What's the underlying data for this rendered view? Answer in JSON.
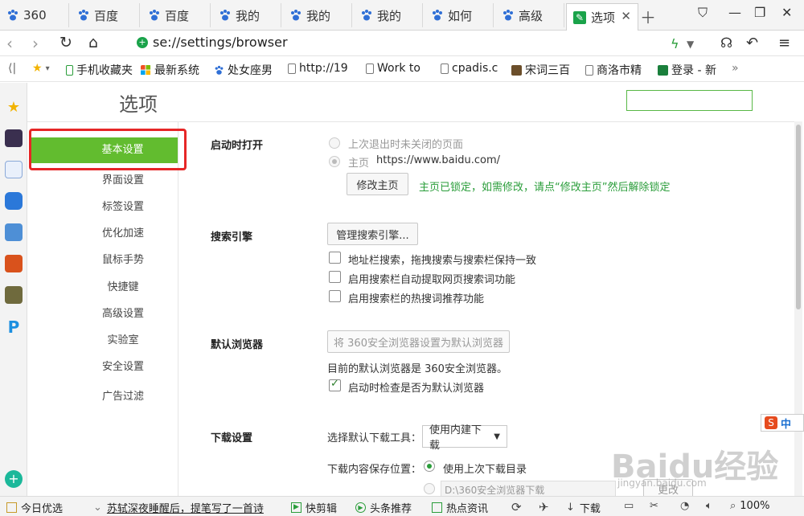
{
  "tabs": [
    {
      "label": "360",
      "icon": "baidu-paw-icon"
    },
    {
      "label": "百度",
      "icon": "baidu-paw-icon"
    },
    {
      "label": "百度",
      "icon": "baidu-paw-icon"
    },
    {
      "label": "我的",
      "icon": "baidu-paw-icon"
    },
    {
      "label": "我的",
      "icon": "baidu-paw-icon"
    },
    {
      "label": "我的",
      "icon": "baidu-paw-icon"
    },
    {
      "label": "如何",
      "icon": "baidu-paw-icon"
    },
    {
      "label": "高级",
      "icon": "baidu-paw-icon"
    },
    {
      "label": "选项",
      "icon": "settings-icon",
      "active": true
    }
  ],
  "address": {
    "url": "se://settings/browser"
  },
  "bookmarks": [
    {
      "label": "手机收藏夹",
      "icon": "phone-icon"
    },
    {
      "label": "最新系统",
      "icon": "windows-icon"
    },
    {
      "label": "处女座男",
      "icon": "baidu-paw-icon"
    },
    {
      "label": "http://19",
      "icon": "page-icon"
    },
    {
      "label": "Work to",
      "icon": "page-icon"
    },
    {
      "label": "cpadis.c",
      "icon": "page-icon"
    },
    {
      "label": "宋词三百",
      "icon": "site-icon"
    },
    {
      "label": "商洛市精",
      "icon": "page-icon"
    },
    {
      "label": "登录 - 新",
      "icon": "login-icon"
    }
  ],
  "bookmarks_more": "»",
  "page": {
    "title": "选项"
  },
  "nav": [
    {
      "label": "基本设置",
      "active": true
    },
    {
      "label": "界面设置"
    },
    {
      "label": "标签设置"
    },
    {
      "label": "优化加速"
    },
    {
      "label": "鼠标手势"
    },
    {
      "label": "快捷键"
    },
    {
      "label": "高级设置"
    },
    {
      "label": "实验室"
    },
    {
      "label": "安全设置"
    },
    {
      "label": "广告过滤"
    }
  ],
  "startup": {
    "title": "启动时打开",
    "opt1": "上次退出时未关闭的页面",
    "opt2_label": "主页",
    "opt2_url": "https://www.baidu.com/",
    "modify_btn": "修改主页",
    "lock_notice": "主页已锁定，如需修改，请点“修改主页”然后解除锁定"
  },
  "search": {
    "title": "搜索引擎",
    "manage_btn": "管理搜索引擎...",
    "chk1": "地址栏搜索，拖拽搜索与搜索栏保持一致",
    "chk2": "启用搜索栏自动提取网页搜索词功能",
    "chk3": "启用搜索栏的热搜词推荐功能"
  },
  "default_browser": {
    "title": "默认浏览器",
    "set_btn": "将 360安全浏览器设置为默认浏览器",
    "status": "目前的默认浏览器是 360安全浏览器。",
    "chk": "启动时检查是否为默认浏览器"
  },
  "download": {
    "title": "下载设置",
    "tool_label": "选择默认下载工具：",
    "tool_value": "使用内建下载",
    "location_label": "下载内容保存位置：",
    "loc_opt1": "使用上次下载目录",
    "loc_path": "D:\\360安全浏览器下载",
    "browse_btn": "更改"
  },
  "ime": {
    "glyph": "S",
    "text": "中"
  },
  "statusbar": {
    "today": "今日优选",
    "headline": "苏轼深夜睡醒后，提笔写了一首诗",
    "clip": "快剪辑",
    "news": "头条推荐",
    "hot": "热点资讯",
    "download": "下载",
    "zoom": "100%"
  },
  "watermark": {
    "main": "Baidu经验",
    "sub": "jingyan.baidu.com"
  },
  "colors": {
    "accent_green": "#62bc2f",
    "highlight_red": "#e62626",
    "notice_green": "#2a9d3a"
  }
}
